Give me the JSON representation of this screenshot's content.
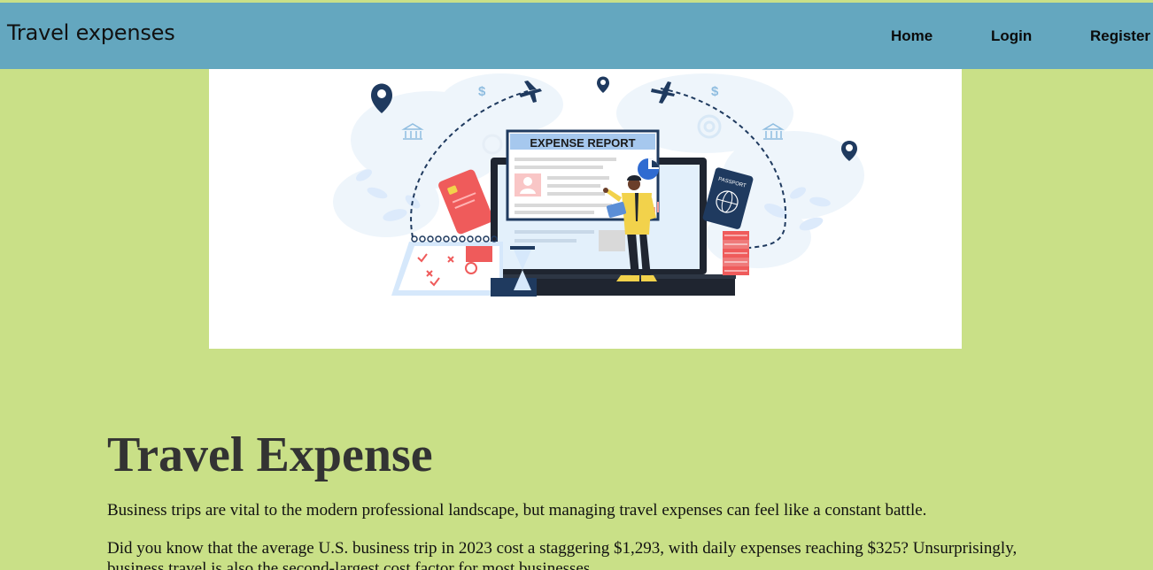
{
  "header": {
    "brand": "Travel expenses",
    "nav": {
      "home": "Home",
      "login": "Login",
      "register": "Register"
    }
  },
  "hero": {
    "report_title": "EXPENSE REPORT",
    "passport_label": "PASSPORT"
  },
  "main": {
    "title": "Travel Expense",
    "paragraphs": [
      "Business trips are vital to the modern professional landscape, but managing travel expenses can feel like a constant battle.",
      "Did you know that the average U.S. business trip in 2023 cost a staggering $1,293, with daily expenses reaching $325? Unsurprisingly, business travel is also the second-largest cost factor for most businesses."
    ]
  },
  "colors": {
    "page_background": "#c9e087",
    "header_background": "#64a7bf",
    "title_text": "#333333",
    "hero_navy": "#1f3a5f",
    "hero_accent_red": "#ef5b5b",
    "hero_accent_yellow": "#f2d24b"
  }
}
